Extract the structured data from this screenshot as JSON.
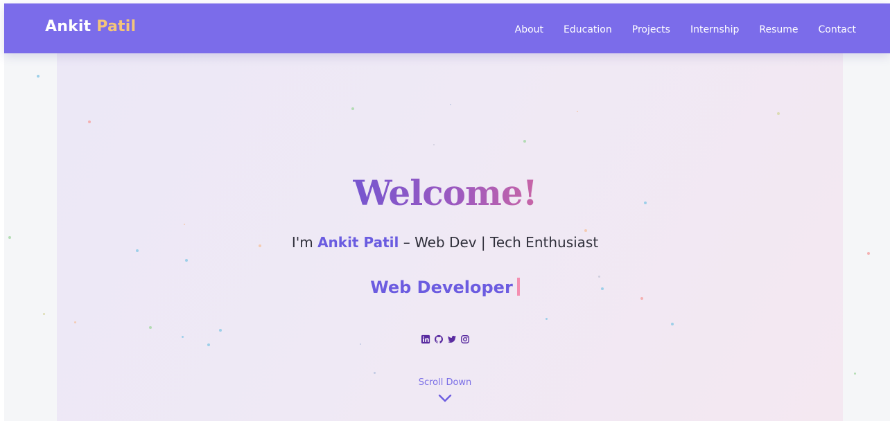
{
  "nav": {
    "brand_first": "Ankit",
    "brand_last": "Patil",
    "links": [
      "About",
      "Education",
      "Projects",
      "Internship",
      "Resume",
      "Contact"
    ]
  },
  "hero": {
    "welcome": "Welcome!",
    "tagline_prefix": "I'm",
    "tagline_name": "Ankit Patil",
    "tagline_suffix": "– Web Dev | Tech Enthusiast",
    "typed_text": "Web Developer",
    "socials": [
      {
        "icon": "linkedin-icon"
      },
      {
        "icon": "github-icon"
      },
      {
        "icon": "twitter-icon"
      },
      {
        "icon": "instagram-icon"
      }
    ],
    "scroll_label": "Scroll Down"
  },
  "colors": {
    "nav_background": "#7b6cea",
    "brand_accent": "#f3c57a",
    "name_accent": "#6a5ce0",
    "cursor": "#f48fb1",
    "social_icons": "#5a2ca0"
  }
}
